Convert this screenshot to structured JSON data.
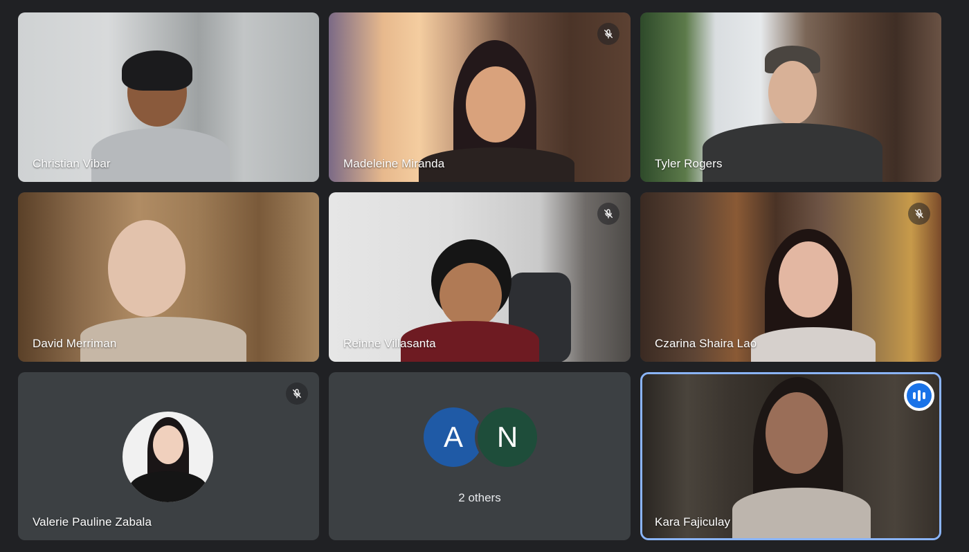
{
  "participants": [
    {
      "name": "Christian Vibar",
      "muted": false
    },
    {
      "name": "Madeleine Miranda",
      "muted": true
    },
    {
      "name": "Tyler Rogers",
      "muted": false
    },
    {
      "name": "David Merriman",
      "muted": false
    },
    {
      "name": "Reinne Villasanta",
      "muted": true
    },
    {
      "name": "Czarina Shaira Lao",
      "muted": true
    },
    {
      "name": "Valerie Pauline Zabala",
      "muted": true
    },
    {
      "name": "Kara Fajiculay",
      "muted": false,
      "speaking": true
    }
  ],
  "others": {
    "initials": [
      "A",
      "N"
    ],
    "label": "2 others"
  },
  "icons": {
    "mute": "mic-off-icon",
    "speaking": "audio-level-icon"
  },
  "colors": {
    "background": "#202124",
    "tile": "#3c4043",
    "active_speaker_border": "#8ab4f8",
    "initial_a": "#1f5aa6",
    "initial_n": "#1e4d3a",
    "speaking_blue": "#1a73e8"
  }
}
